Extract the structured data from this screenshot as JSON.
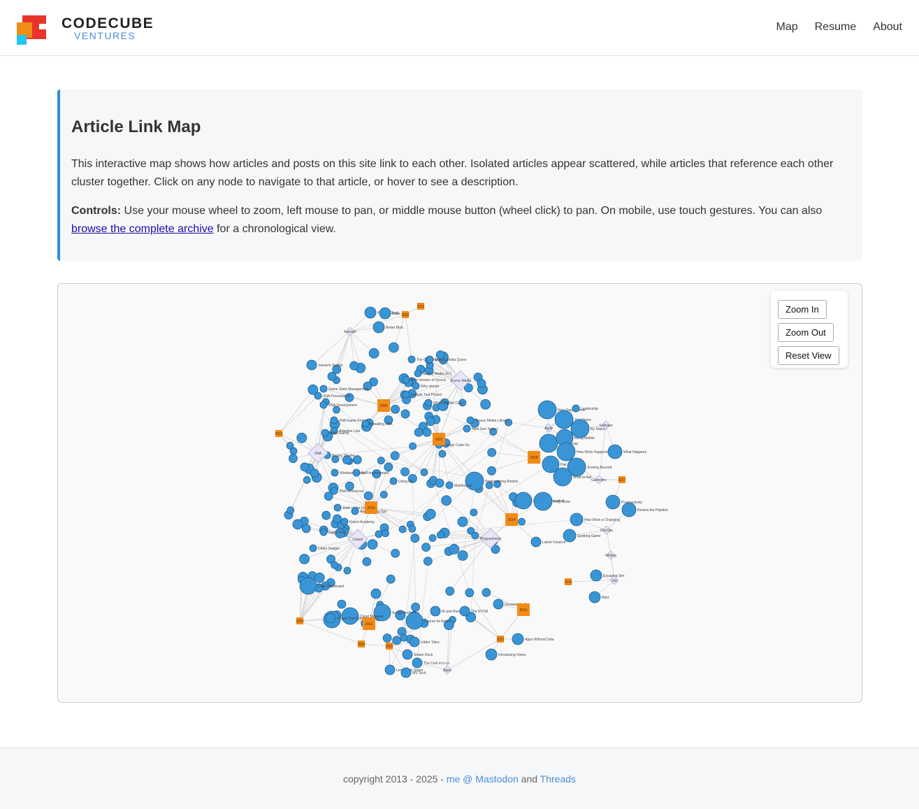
{
  "brand": {
    "name": "CODECUBE",
    "sub": "VENTURES"
  },
  "nav": {
    "map": "Map",
    "resume": "Resume",
    "about": "About"
  },
  "intro": {
    "title": "Article Link Map",
    "description": "This interactive map shows how articles and posts on this site link to each other. Isolated articles appear scattered, while articles that reference each other cluster together. Click on any node to navigate to that article, or hover to see a description.",
    "controls_label": "Controls:",
    "controls_text": " Use your mouse wheel to zoom, left mouse to pan, or middle mouse button (wheel click) to pan. On mobile, use touch gestures. You can also ",
    "archive_link": "browse the complete archive",
    "controls_tail": " for a chronological view."
  },
  "controls": {
    "zoom_in": "Zoom In",
    "zoom_out": "Zoom Out",
    "reset": "Reset View"
  },
  "colors": {
    "article": "#3a95d6",
    "year": "#f38b17",
    "tag": "#e8e6f7",
    "tag_stroke": "#b2acd8",
    "edge": "#d2d2d2",
    "accent": "#2b90d9"
  },
  "graph": {
    "articles": [
      {
        "label": "F# And Cloud",
        "r": 8
      },
      {
        "label": "Days",
        "r": 8
      },
      {
        "label": "Better Blob",
        "r": 8
      },
      {
        "label": "Xamarin Staffan",
        "r": 7
      },
      {
        "label": "The Challenge",
        "r": 5
      },
      {
        "label": "Scurvy Media Quest",
        "r": 5
      },
      {
        "label": "Scurvy Media v0.7",
        "r": 5
      },
      {
        "label": "New Version of Scurvy",
        "r": 5
      },
      {
        "label": "Why stories",
        "r": 5
      },
      {
        "label": "Game State Management",
        "r": 5
      },
      {
        "label": "XNA Presentation",
        "r": 5
      },
      {
        "label": "XNA Development",
        "r": 5
      },
      {
        "label": "Sample Test Project",
        "r": 5
      },
      {
        "label": "XBox and the Case",
        "r": 5
      },
      {
        "label": "Scurvy Media Library",
        "r": 5
      },
      {
        "label": "XNA Game Engine",
        "r": 5
      },
      {
        "label": "Installing XNA",
        "r": 5
      },
      {
        "label": "Adaptive Line",
        "r": 5
      },
      {
        "label": "XNA Source",
        "r": 5
      },
      {
        "label": "Next Gen Scurvy",
        "r": 5
      },
      {
        "label": "Design Code Go",
        "r": 5
      },
      {
        "label": "Scurvy Shader",
        "r": 5
      },
      {
        "label": "Windows Phone 7",
        "r": 5
      },
      {
        "label": "Self-Improvement",
        "r": 5
      },
      {
        "label": "Using Git",
        "r": 5
      },
      {
        "label": "Programming Models",
        "r": 13
      },
      {
        "label": "Mathbasker",
        "r": 5
      },
      {
        "label": "XNA Resources",
        "r": 5
      },
      {
        "label": "State of the Union",
        "r": 5
      },
      {
        "label": "Approaching Tips",
        "r": 5
      },
      {
        "label": "Kinect Academy",
        "r": 5
      },
      {
        "label": "Game Hub",
        "r": 5
      },
      {
        "label": "Udder Nudger",
        "r": 5
      },
      {
        "label": "Daily Dashboard",
        "r": 12
      },
      {
        "label": "Running Powershell",
        "r": 12
      },
      {
        "label": "Fully Grow",
        "r": 13
      },
      {
        "label": "How Teams Grow",
        "r": 13
      },
      {
        "label": "Your Team",
        "r": 13
      },
      {
        "label": "Leadership",
        "r": 5
      },
      {
        "label": "DeploySnap",
        "r": 13
      },
      {
        "label": "Being Mobile",
        "r": 12
      },
      {
        "label": "By Status",
        "r": 13
      },
      {
        "label": "How Work Happens",
        "r": 13
      },
      {
        "label": "Pair Rank",
        "r": 12
      },
      {
        "label": "Scoring Beyond",
        "r": 13
      },
      {
        "label": "What to Ask",
        "r": 13
      },
      {
        "label": "What Happens",
        "r": 10
      },
      {
        "label": "Progressively",
        "r": 10
      },
      {
        "label": "Review the Pipeline",
        "r": 10
      },
      {
        "label": "How Work is Changing",
        "r": 9
      },
      {
        "label": "Spotting Game",
        "r": 9
      },
      {
        "label": "Latest Vsource",
        "r": 7
      },
      {
        "label": "Escaping Sim",
        "r": 8
      },
      {
        "label": "Alert",
        "r": 8
      },
      {
        "label": "Kitchen",
        "r": 12
      },
      {
        "label": "Social Media Diet",
        "r": 12
      },
      {
        "label": "Cloud Manager",
        "r": 12
      },
      {
        "label": "Course for Azure",
        "r": 12
      },
      {
        "label": "AI and Humans",
        "r": 7
      },
      {
        "label": "The NYTM",
        "r": 7
      },
      {
        "label": "Dynamic Audio",
        "r": 7
      },
      {
        "label": "Apps Without Data",
        "r": 8
      },
      {
        "label": "Introducing Views",
        "r": 8
      },
      {
        "label": "Udder Tales",
        "r": 7
      },
      {
        "label": "Steam Deck",
        "r": 7
      },
      {
        "label": "The Cost of a Lo",
        "r": 7
      },
      {
        "label": "Lemonade Stand",
        "r": 7
      },
      {
        "label": "MS Tech",
        "r": 7
      },
      {
        "label": "Where The Good",
        "r": 7
      }
    ],
    "years": [
      "2015",
      "2018",
      "2009",
      "2013",
      "2007",
      "2008",
      "2010",
      "2017",
      "2014",
      "2016",
      "2012",
      "2011",
      "2023",
      "2020",
      "2022",
      "2021"
    ],
    "tags": [
      "Scurvy Media",
      "Xamarin",
      "XNA",
      "Programming",
      "Agile",
      "Apps",
      "Career",
      "DevOps",
      "Software",
      "Writing",
      "Job",
      "Gamedev"
    ]
  },
  "footer": {
    "prefix": "copyright 2013 - 2025 - ",
    "mastodon": "me @ Mastodon",
    "and": " and ",
    "threads": "Threads"
  }
}
